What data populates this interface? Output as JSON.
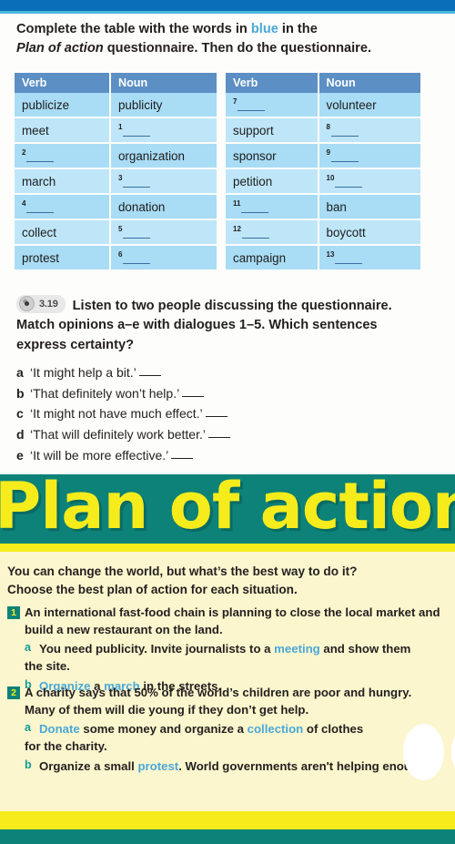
{
  "page": {
    "top_bar_color": "#0a6fb8",
    "accent_blue": "#4aa8d8",
    "teal": "#0d8278",
    "yellow": "#f6ec1c"
  },
  "instruction": {
    "part1": "Complete the table with the words in ",
    "blue_word": "blue",
    "part2": " in the",
    "line2_italic": "Plan of action",
    "line2_rest": " questionnaire. Then do the questionnaire."
  },
  "tables": {
    "headers": [
      "Verb",
      "Noun"
    ],
    "left_rows": [
      {
        "verb": "publicize",
        "verb_num": "",
        "noun": "publicity",
        "noun_num": ""
      },
      {
        "verb": "meet",
        "verb_num": "",
        "noun": "",
        "noun_num": "1"
      },
      {
        "verb": "",
        "verb_num": "2",
        "noun": "organization",
        "noun_num": ""
      },
      {
        "verb": "march",
        "verb_num": "",
        "noun": "",
        "noun_num": "3"
      },
      {
        "verb": "",
        "verb_num": "4",
        "noun": "donation",
        "noun_num": ""
      },
      {
        "verb": "collect",
        "verb_num": "",
        "noun": "",
        "noun_num": "5"
      },
      {
        "verb": "protest",
        "verb_num": "",
        "noun": "",
        "noun_num": "6"
      }
    ],
    "right_rows": [
      {
        "verb": "",
        "verb_num": "7",
        "noun": "volunteer",
        "noun_num": ""
      },
      {
        "verb": "support",
        "verb_num": "",
        "noun": "",
        "noun_num": "8"
      },
      {
        "verb": "sponsor",
        "verb_num": "",
        "noun": "",
        "noun_num": "9"
      },
      {
        "verb": "petition",
        "verb_num": "",
        "noun": "",
        "noun_num": "10"
      },
      {
        "verb": "",
        "verb_num": "11",
        "noun": "ban",
        "noun_num": ""
      },
      {
        "verb": "",
        "verb_num": "12",
        "noun": "boycott",
        "noun_num": ""
      },
      {
        "verb": "campaign",
        "verb_num": "",
        "noun": "",
        "noun_num": "13"
      }
    ]
  },
  "listening": {
    "track": "3.19",
    "icon": "cd-disc-icon",
    "text_line1": "Listen to two people discussing the questionnaire.",
    "text_line2": "Match opinions a–e with dialogues 1–5. Which sentences",
    "text_line3": "express certainty?",
    "options": [
      {
        "letter": "a",
        "text": "‘It might help a bit.’"
      },
      {
        "letter": "b",
        "text": "‘That definitely won’t help.’"
      },
      {
        "letter": "c",
        "text": "‘It might not have much effect.’"
      },
      {
        "letter": "d",
        "text": "‘That will definitely work better.’"
      },
      {
        "letter": "e",
        "text": "‘It will be more effective.’"
      }
    ]
  },
  "banner": {
    "title": "Plan of action"
  },
  "questionnaire": {
    "intro_line1": "You can change the world, but what’s the best way to do it?",
    "intro_line2": "Choose the best plan of action for each situation.",
    "situations": [
      {
        "number": "1",
        "text": "An international fast-food chain is planning to close the local market and\nbuild a new restaurant on the land.",
        "options": [
          {
            "letter": "a",
            "parts": [
              {
                "t": "You need publicity. Invite journalists to a ",
                "hl": false
              },
              {
                "t": "meeting",
                "hl": true
              },
              {
                "t": " and show them\nthe site.",
                "hl": false
              }
            ]
          },
          {
            "letter": "b",
            "parts": [
              {
                "t": "Organize",
                "hl": true
              },
              {
                "t": " a ",
                "hl": false
              },
              {
                "t": "march",
                "hl": true
              },
              {
                "t": " in the streets.",
                "hl": false
              }
            ]
          }
        ]
      },
      {
        "number": "2",
        "text": "A charity says that 50% of the world’s children are poor and hungry.\nMany of them will die young if they don’t get help.",
        "options": [
          {
            "letter": "a",
            "parts": [
              {
                "t": "Donate",
                "hl": true
              },
              {
                "t": " some money and organize a ",
                "hl": false
              },
              {
                "t": "collection",
                "hl": true
              },
              {
                "t": " of clothes\nfor the charity.",
                "hl": false
              }
            ]
          },
          {
            "letter": "b",
            "parts": [
              {
                "t": "Organize a small ",
                "hl": false
              },
              {
                "t": "protest",
                "hl": true
              },
              {
                "t": ". World governments aren't helping enough.",
                "hl": false
              }
            ]
          }
        ]
      }
    ]
  }
}
